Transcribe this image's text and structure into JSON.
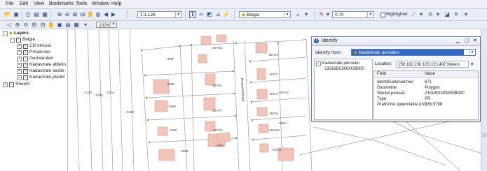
{
  "menu": [
    "File",
    "Edit",
    "View",
    "Bookmarks",
    "Tools",
    "Window",
    "Help"
  ],
  "toolbar": {
    "scale_value": "1:1.126",
    "layer_combo": "Belgie",
    "line_width": "0.70",
    "highlighter_label": "Highlighter",
    "zoom_value": "100%"
  },
  "toc": {
    "root_label": "Layers",
    "group_label": "Belgie",
    "layers": [
      "CD inhoud",
      "Provincies",
      "Gemeenten",
      "Kadastrale afdelin",
      "Kadastrale sectie",
      "Kadastrale planbl"
    ],
    "sheet_label": "Sheet0"
  },
  "map": {
    "street_label": "Brouwersstraat",
    "parcels": [
      "-309F",
      "-309E",
      "-309D",
      "-309C",
      "-309B",
      "-287M4",
      "-287N4",
      "-287P4",
      "-287S4",
      "-287R4",
      "-287T4",
      "-287L4",
      "-287K4",
      "-287W4",
      "-287H4",
      "-286H",
      "-312B",
      "-314D",
      "-314C",
      "-313A",
      "-308H",
      "-287V4"
    ]
  },
  "identify": {
    "title": "Identify",
    "from_label": "Identify from:",
    "from_value": "Kadastrale percelen",
    "tree_parent": "Kadastrale percelen",
    "tree_child": "23018D0309/00B000",
    "location_label": "Location:",
    "location_value": "158.182,238  183.133,492 Meters",
    "col_field": "Field",
    "col_value": "Value",
    "rows": [
      {
        "field": "Identificatienummer",
        "value": "671"
      },
      {
        "field": "Geometrie",
        "value": "Polygon"
      },
      {
        "field": "Sleutel perceel",
        "value": "23018D0309/00B000"
      },
      {
        "field": "Type",
        "value": "PR"
      },
      {
        "field": "Grafische oppervlakte (m²)",
        "value": "736,9798"
      }
    ]
  },
  "colors": {
    "accent": "#2e5fae",
    "building": "#f2c4b8",
    "parcel_line": "#9aa0a6",
    "vertex": "#5aa02c"
  }
}
